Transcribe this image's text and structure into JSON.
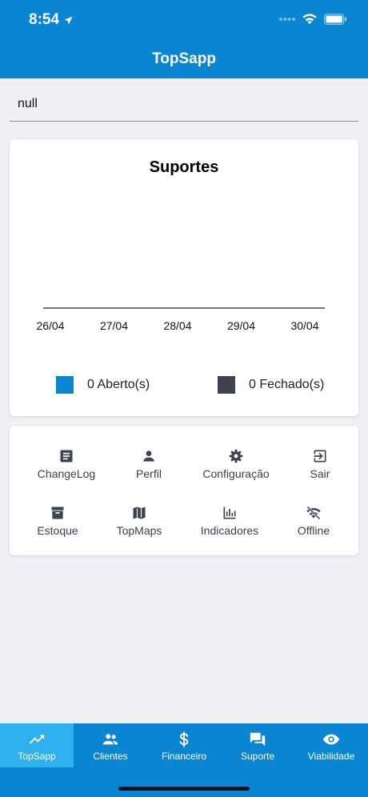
{
  "status_bar": {
    "time": "8:54"
  },
  "header": {
    "title": "TopSapp"
  },
  "user_field": {
    "value": "null"
  },
  "chart_data": {
    "type": "line",
    "title": "Suportes",
    "categories": [
      "26/04",
      "27/04",
      "28/04",
      "29/04",
      "30/04"
    ],
    "series": [
      {
        "name": "0 Aberto(s)",
        "color": "#0a85d1",
        "values": [
          0,
          0,
          0,
          0,
          0
        ]
      },
      {
        "name": "0 Fechado(s)",
        "color": "#3e4350",
        "values": [
          0,
          0,
          0,
          0,
          0
        ]
      }
    ],
    "grid": false,
    "legend_position": "bottom"
  },
  "menu": {
    "items": [
      {
        "label": "ChangeLog",
        "icon": "document-icon"
      },
      {
        "label": "Perfil",
        "icon": "person-icon"
      },
      {
        "label": "Configuração",
        "icon": "gear-icon"
      },
      {
        "label": "Sair",
        "icon": "exit-icon"
      },
      {
        "label": "Estoque",
        "icon": "archive-icon"
      },
      {
        "label": "TopMaps",
        "icon": "map-icon"
      },
      {
        "label": "Indicadores",
        "icon": "bar-chart-icon"
      },
      {
        "label": "Offline",
        "icon": "wifi-off-icon"
      }
    ]
  },
  "bottom_nav": {
    "items": [
      {
        "label": "TopSapp",
        "icon": "trending-up-icon",
        "active": true
      },
      {
        "label": "Clientes",
        "icon": "people-icon",
        "active": false
      },
      {
        "label": "Financeiro",
        "icon": "dollar-icon",
        "active": false
      },
      {
        "label": "Suporte",
        "icon": "chat-icon",
        "active": false
      },
      {
        "label": "Viabilidade",
        "icon": "eye-icon",
        "active": false
      }
    ]
  }
}
